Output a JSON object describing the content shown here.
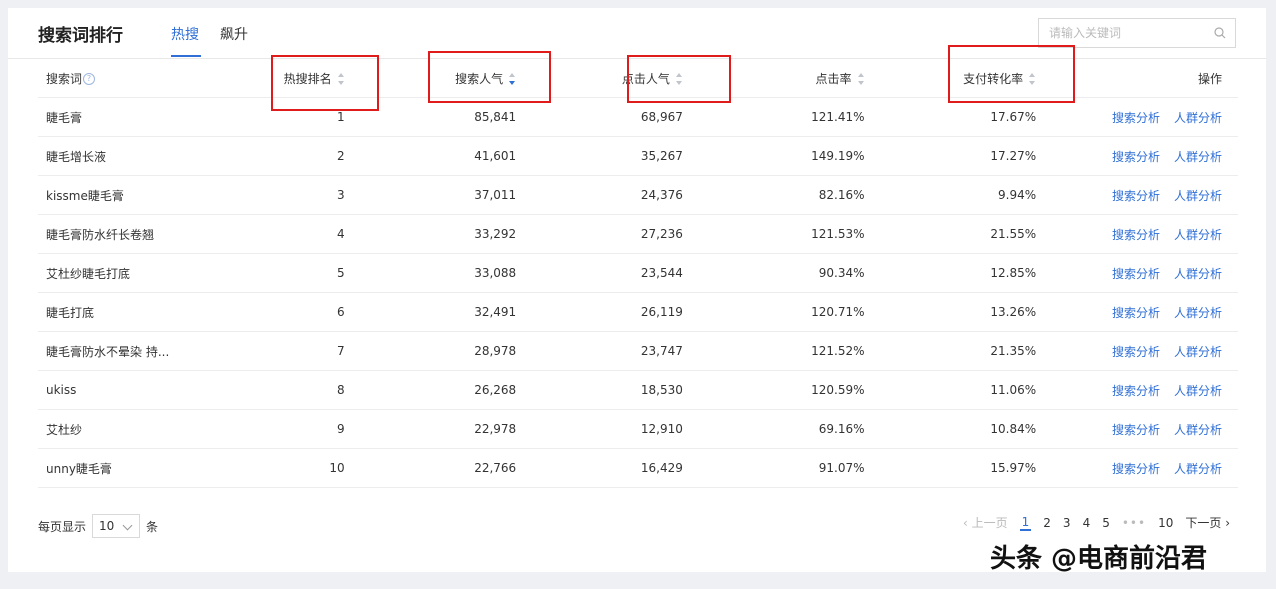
{
  "header": {
    "title": "搜索词排行",
    "tabs": [
      {
        "label": "热搜",
        "active": true
      },
      {
        "label": "飙升",
        "active": false
      }
    ],
    "search_placeholder": "请输入关键词"
  },
  "table": {
    "columns": {
      "keyword": "搜索词",
      "rank": "热搜排名",
      "search_pop": "搜索人气",
      "click_pop": "点击人气",
      "ctr": "点击率",
      "pay_rate": "支付转化率",
      "action": "操作"
    },
    "actions": {
      "search_analysis": "搜索分析",
      "crowd_analysis": "人群分析"
    },
    "rows": [
      {
        "keyword": "睫毛膏",
        "rank": "1",
        "search_pop": "85,841",
        "click_pop": "68,967",
        "ctr": "121.41%",
        "pay_rate": "17.67%"
      },
      {
        "keyword": "睫毛增长液",
        "rank": "2",
        "search_pop": "41,601",
        "click_pop": "35,267",
        "ctr": "149.19%",
        "pay_rate": "17.27%"
      },
      {
        "keyword": "kissme睫毛膏",
        "rank": "3",
        "search_pop": "37,011",
        "click_pop": "24,376",
        "ctr": "82.16%",
        "pay_rate": "9.94%"
      },
      {
        "keyword": "睫毛膏防水纤长卷翘",
        "rank": "4",
        "search_pop": "33,292",
        "click_pop": "27,236",
        "ctr": "121.53%",
        "pay_rate": "21.55%"
      },
      {
        "keyword": "艾杜纱睫毛打底",
        "rank": "5",
        "search_pop": "33,088",
        "click_pop": "23,544",
        "ctr": "90.34%",
        "pay_rate": "12.85%"
      },
      {
        "keyword": "睫毛打底",
        "rank": "6",
        "search_pop": "32,491",
        "click_pop": "26,119",
        "ctr": "120.71%",
        "pay_rate": "13.26%"
      },
      {
        "keyword": "睫毛膏防水不晕染 持...",
        "rank": "7",
        "search_pop": "28,978",
        "click_pop": "23,747",
        "ctr": "121.52%",
        "pay_rate": "21.35%"
      },
      {
        "keyword": "ukiss",
        "rank": "8",
        "search_pop": "26,268",
        "click_pop": "18,530",
        "ctr": "120.59%",
        "pay_rate": "11.06%"
      },
      {
        "keyword": "艾杜纱",
        "rank": "9",
        "search_pop": "22,978",
        "click_pop": "12,910",
        "ctr": "69.16%",
        "pay_rate": "10.84%"
      },
      {
        "keyword": "unny睫毛膏",
        "rank": "10",
        "search_pop": "22,766",
        "click_pop": "16,429",
        "ctr": "91.07%",
        "pay_rate": "15.97%"
      }
    ]
  },
  "pagination": {
    "per_page_label": "每页显示",
    "per_page_value": "10",
    "per_page_unit": "条",
    "prev": "上一页",
    "next": "下一页",
    "pages": [
      "1",
      "2",
      "3",
      "4",
      "5"
    ],
    "ellipsis": "•••",
    "last_page": "10",
    "current": "1"
  },
  "watermark": "头条 @电商前沿君",
  "colors": {
    "accent": "#2f6fd6",
    "highlight_box": "#e01b1b"
  }
}
